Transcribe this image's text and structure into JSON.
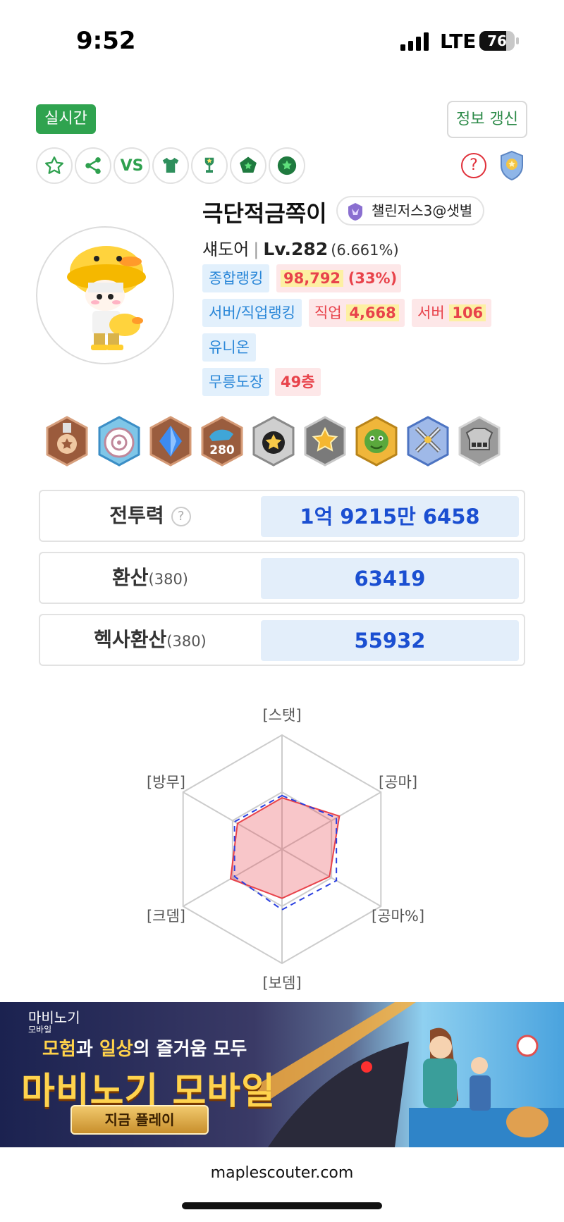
{
  "status_bar": {
    "time": "9:52",
    "network": "LTE",
    "battery": "76",
    "battery_level": 0.76
  },
  "header": {
    "realtime_label": "실시간",
    "refresh_label": "정보 갱신",
    "vs_label": "VS",
    "help_icon": "?"
  },
  "icon_row": [
    "star-icon",
    "share-icon",
    "vs-icon",
    "shirt-icon",
    "trophy-icon",
    "pentagon-badge-icon",
    "star-circle-icon"
  ],
  "character": {
    "name": "극단적금쪽이",
    "guild": "챌린저스3@샛별",
    "class": "섀도어",
    "level": "Lv.282",
    "level_percent": "(6.661%)",
    "overall_rank_label": "종합랭킹",
    "overall_rank_value": "98,792",
    "overall_rank_percent": "(33%)",
    "server_job_rank_label": "서버/직업랭킹",
    "job_label": "직업",
    "job_rank": "4,668",
    "server_label": "서버",
    "server_rank": "106",
    "union_label": "유니온",
    "dojo_label": "무릉도장",
    "dojo_value": "49층"
  },
  "achievements": [
    "bronze-medal-icon",
    "target-medal-icon",
    "blue-gem-icon",
    "level-280-icon",
    "black-star-icon",
    "gold-star-icon",
    "green-dragon-icon",
    "crossed-swords-icon",
    "armor-icon"
  ],
  "achievement_badge_text": "280",
  "stats": [
    {
      "label": "전투력",
      "sub": "",
      "value": "1억 9215만 6458"
    },
    {
      "label": "환산",
      "sub": "(380)",
      "value": "63419"
    },
    {
      "label": "헥사환산",
      "sub": "(380)",
      "value": "55932"
    }
  ],
  "radar": {
    "axes": [
      "[스탯]",
      "[공마]",
      "[공마%]",
      "[보뎀]",
      "[크뎀]",
      "[방무]"
    ],
    "series": [
      {
        "values": [
          0.45,
          0.58,
          0.48,
          0.43,
          0.52,
          0.45
        ],
        "color": "#e8434b"
      },
      {
        "values": [
          0.47,
          0.55,
          0.55,
          0.53,
          0.48,
          0.48
        ],
        "color": "#2a3fe0"
      }
    ]
  },
  "ad": {
    "brand": "마비노기",
    "brand_sub": "모바일",
    "tagline_part1": "모험",
    "tagline_part2": "과 ",
    "tagline_part3": "일상",
    "tagline_part4": "의 즐거움 모두",
    "title": "마비노기 모바일",
    "play_button": "지금 플레이"
  },
  "footer": {
    "url": "maplescouter.com"
  }
}
